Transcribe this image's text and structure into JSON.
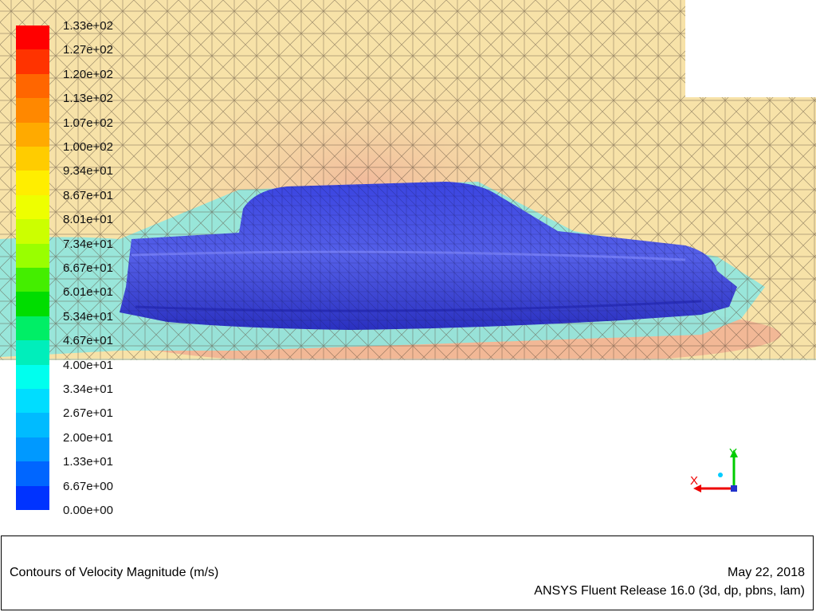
{
  "colormap": {
    "labels": [
      "1.33e+02",
      "1.27e+02",
      "1.20e+02",
      "1.13e+02",
      "1.07e+02",
      "1.00e+02",
      "9.34e+01",
      "8.67e+01",
      "8.01e+01",
      "7.34e+01",
      "6.67e+01",
      "6.01e+01",
      "5.34e+01",
      "4.67e+01",
      "4.00e+01",
      "3.34e+01",
      "2.67e+01",
      "2.00e+01",
      "1.33e+01",
      "6.67e+00",
      "0.00e+00"
    ],
    "colors": [
      "#ff0000",
      "#ff3300",
      "#ff6600",
      "#ff8800",
      "#ffaa00",
      "#ffcc00",
      "#ffee00",
      "#eeff00",
      "#ccff00",
      "#99ff00",
      "#44ee00",
      "#00dd00",
      "#00ee66",
      "#00eebb",
      "#00ffee",
      "#00ddff",
      "#00bbff",
      "#0099ff",
      "#0066ff",
      "#0033ff"
    ]
  },
  "axes": {
    "x_label": "X",
    "y_label": "Y"
  },
  "footer": {
    "title": "Contours of Velocity Magnitude (m/s)",
    "date": "May 22, 2018",
    "solver": "ANSYS Fluent Release 16.0 (3d, dp, pbns, lam)"
  },
  "colors": {
    "freestream": "#f7e2a8",
    "stagnation_halo": "#f2bfa0",
    "near_wall": "#88e8e0",
    "body": "#3340dd",
    "mesh_line": "#5a4a3a"
  }
}
